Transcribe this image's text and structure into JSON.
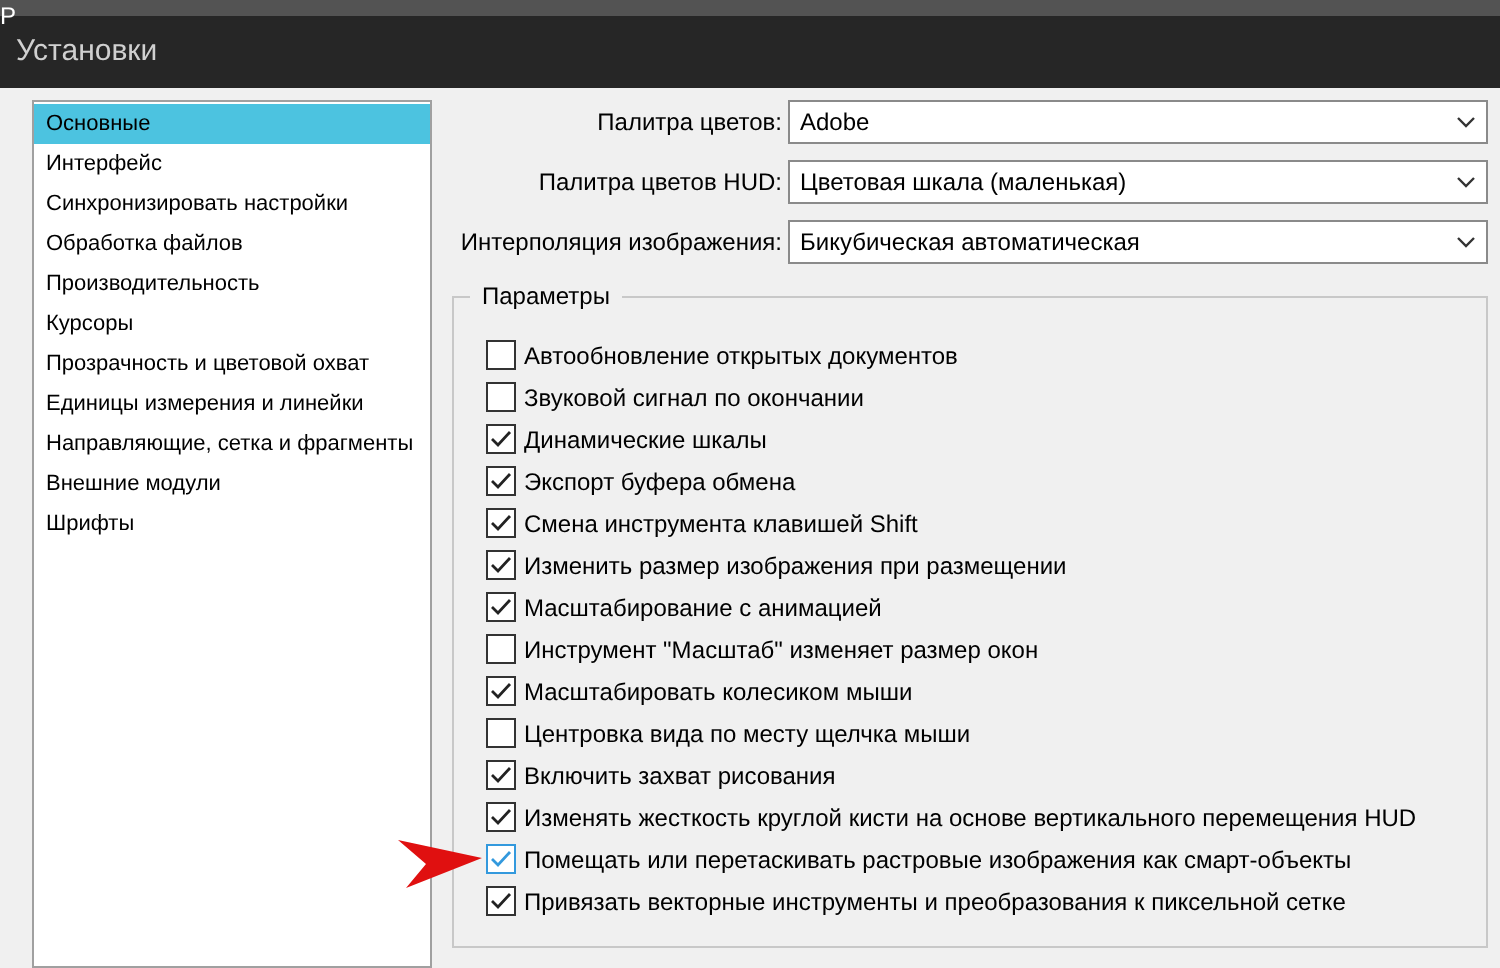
{
  "background_app": {
    "edge_text": "P"
  },
  "window": {
    "title": "Установки"
  },
  "sidebar": {
    "items": [
      {
        "label": "Основные",
        "selected": true
      },
      {
        "label": "Интерфейс",
        "selected": false
      },
      {
        "label": "Синхронизировать настройки",
        "selected": false
      },
      {
        "label": "Обработка файлов",
        "selected": false
      },
      {
        "label": "Производительность",
        "selected": false
      },
      {
        "label": "Курсоры",
        "selected": false
      },
      {
        "label": "Прозрачность и цветовой охват",
        "selected": false
      },
      {
        "label": "Единицы измерения и линейки",
        "selected": false
      },
      {
        "label": "Направляющие, сетка и фрагменты",
        "selected": false
      },
      {
        "label": "Внешние модули",
        "selected": false
      },
      {
        "label": "Шрифты",
        "selected": false
      }
    ]
  },
  "fields": [
    {
      "label": "Палитра цветов:",
      "value": "Adobe"
    },
    {
      "label": "Палитра цветов HUD:",
      "value": "Цветовая шкала (маленькая)"
    },
    {
      "label": "Интерполяция изображения:",
      "value": "Бикубическая автоматическая"
    }
  ],
  "options": {
    "title": "Параметры",
    "items": [
      {
        "label": "Автообновление открытых документов",
        "checked": false,
        "focused": false
      },
      {
        "label": "Звуковой сигнал по окончании",
        "checked": false,
        "focused": false
      },
      {
        "label": "Динамические шкалы",
        "checked": true,
        "focused": false
      },
      {
        "label": "Экспорт буфера обмена",
        "checked": true,
        "focused": false
      },
      {
        "label": "Смена инструмента клавишей Shift",
        "checked": true,
        "focused": false
      },
      {
        "label": "Изменить размер изображения при размещении",
        "checked": true,
        "focused": false
      },
      {
        "label": "Масштабирование с анимацией",
        "checked": true,
        "focused": false
      },
      {
        "label": "Инструмент \"Масштаб\" изменяет размер окон",
        "checked": false,
        "focused": false
      },
      {
        "label": "Масштабировать колесиком мыши",
        "checked": true,
        "focused": false
      },
      {
        "label": "Центровка вида по месту щелчка мыши",
        "checked": false,
        "focused": false
      },
      {
        "label": "Включить захват рисования",
        "checked": true,
        "focused": false
      },
      {
        "label": "Изменять жесткость круглой кисти на основе вертикального перемещения HUD",
        "checked": true,
        "focused": false
      },
      {
        "label": "Помещать или перетаскивать растровые изображения как смарт-объекты",
        "checked": true,
        "focused": true
      },
      {
        "label": "Привязать векторные инструменты и преобразования к пиксельной сетке",
        "checked": true,
        "focused": false
      }
    ]
  }
}
